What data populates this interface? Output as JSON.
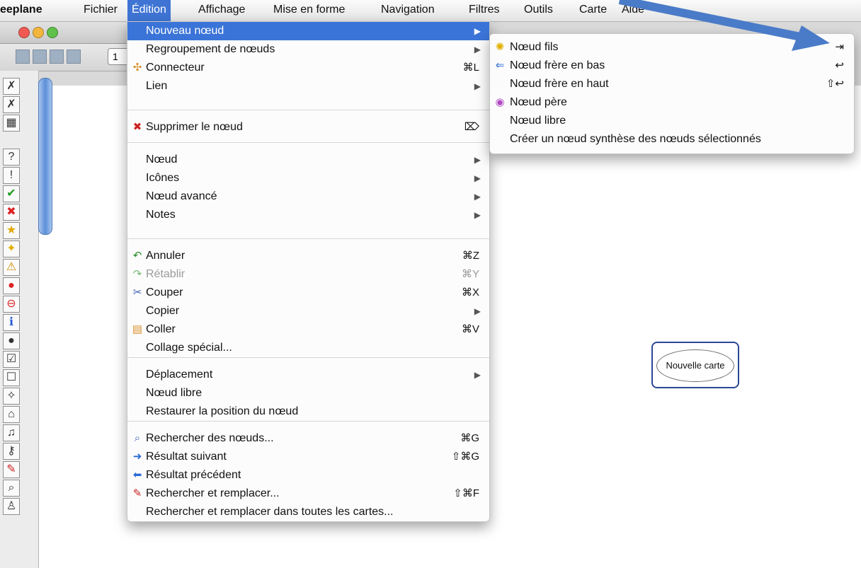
{
  "menubar": {
    "app": "eeplane",
    "items": [
      "Fichier",
      "Édition",
      "Affichage",
      "Mise en forme",
      "Navigation",
      "Filtres",
      "Outils",
      "Carte",
      "Aide"
    ]
  },
  "toolbar": {
    "zoom_value": "1"
  },
  "node": {
    "label": "Nouvelle carte"
  },
  "edition_menu": [
    {
      "label": "Nouveau nœud",
      "icon": "",
      "shortcut": "",
      "submenu": true,
      "highlight": true
    },
    {
      "label": "Regroupement de nœuds",
      "icon": "",
      "shortcut": "",
      "submenu": true
    },
    {
      "label": "Connecteur",
      "icon": "connector-icon",
      "shortcut": "⌘L"
    },
    {
      "label": "Lien",
      "icon": "",
      "shortcut": "",
      "submenu": true
    },
    {
      "label": "Supprimer le nœud",
      "icon": "delete-node-icon",
      "shortcut": "⌦"
    },
    {
      "label": "Nœud",
      "icon": "",
      "shortcut": "",
      "submenu": true
    },
    {
      "label": "Icônes",
      "icon": "",
      "shortcut": "",
      "submenu": true
    },
    {
      "label": "Nœud avancé",
      "icon": "",
      "shortcut": "",
      "submenu": true
    },
    {
      "label": "Notes",
      "icon": "",
      "shortcut": "",
      "submenu": true
    },
    {
      "label": "Annuler",
      "icon": "undo-icon",
      "shortcut": "⌘Z"
    },
    {
      "label": "Rétablir",
      "icon": "redo-icon",
      "shortcut": "⌘Y",
      "disabled": true
    },
    {
      "label": "Couper",
      "icon": "scissors-icon",
      "shortcut": "⌘X"
    },
    {
      "label": "Copier",
      "icon": "",
      "shortcut": "",
      "submenu": true
    },
    {
      "label": "Coller",
      "icon": "paste-icon",
      "shortcut": "⌘V"
    },
    {
      "label": "Collage spécial...",
      "icon": "",
      "shortcut": ""
    },
    {
      "label": "Déplacement",
      "icon": "",
      "shortcut": "",
      "submenu": true
    },
    {
      "label": "Nœud libre",
      "icon": "",
      "shortcut": ""
    },
    {
      "label": "Restaurer la position du nœud",
      "icon": "",
      "shortcut": ""
    },
    {
      "label": "Rechercher des nœuds...",
      "icon": "search-icon",
      "shortcut": "⌘G"
    },
    {
      "label": "Résultat suivant",
      "icon": "next-result-icon",
      "shortcut": "⇧⌘G"
    },
    {
      "label": "Résultat précédent",
      "icon": "previous-result-icon",
      "shortcut": ""
    },
    {
      "label": "Rechercher et remplacer...",
      "icon": "find-replace-icon",
      "shortcut": "⇧⌘F"
    },
    {
      "label": "Rechercher et remplacer dans toutes les cartes...",
      "icon": "",
      "shortcut": ""
    }
  ],
  "nouveau_noeud_submenu": [
    {
      "label": "Nœud fils",
      "icon": "lightbulb-icon",
      "shortcut": "⇥"
    },
    {
      "label": "Nœud frère en bas",
      "icon": "sibling-node-icon",
      "shortcut": "↩"
    },
    {
      "label": "Nœud frère en haut",
      "icon": "",
      "shortcut": "⇧↩"
    },
    {
      "label": "Nœud père",
      "icon": "parent-node-icon",
      "shortcut": ""
    },
    {
      "label": "Nœud libre",
      "icon": "",
      "shortcut": ""
    },
    {
      "label": "Créer un nœud synthèse des nœuds sélectionnés",
      "icon": "",
      "shortcut": ""
    }
  ],
  "colors": {
    "highlight": "#3b74d8",
    "node_border": "#2c4696",
    "annotation_arrow": "#4a7bc8"
  }
}
